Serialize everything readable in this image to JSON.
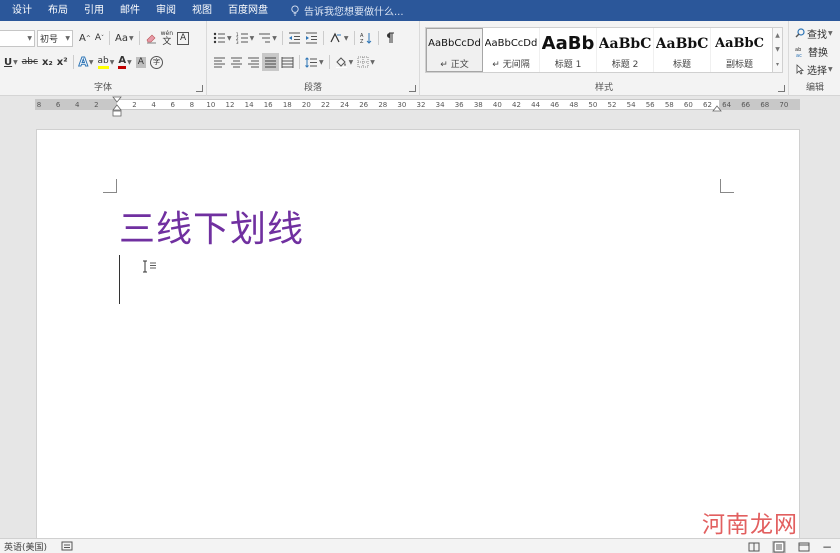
{
  "tabs": [
    "设计",
    "布局",
    "引用",
    "邮件",
    "审阅",
    "视图",
    "百度网盘"
  ],
  "tell_me": "告诉我您想要做什么...",
  "font": {
    "size": "初号",
    "grow_label": "A",
    "shrink_label": "A",
    "case_label": "Aa",
    "phonetic_label": "wén",
    "phonetic_char": "文",
    "border_char": "A",
    "underline_label": "U",
    "strike_label": "abc",
    "sub_label": "x₂",
    "sup_label": "x²",
    "effects_label": "A",
    "highlight_label": "ab",
    "color_label": "A",
    "shade_label": "A",
    "enclose_label": "字",
    "group_label": "字体"
  },
  "paragraph": {
    "group_label": "段落"
  },
  "styles": {
    "group_label": "样式",
    "items": [
      {
        "sample": "AaBbCcDd",
        "name": "↵ 正文"
      },
      {
        "sample": "AaBbCcDd",
        "name": "↵ 无间隔"
      },
      {
        "sample": "AaBb",
        "name": "标题 1"
      },
      {
        "sample": "AaBbC",
        "name": "标题 2"
      },
      {
        "sample": "AaBbC",
        "name": "标题"
      },
      {
        "sample": "AaBbC",
        "name": "副标题"
      }
    ]
  },
  "editing": {
    "find": "查找",
    "replace": "替换",
    "select": "选择",
    "group_label": "编辑"
  },
  "ruler": {
    "numbers": [
      "8",
      "6",
      "4",
      "2",
      "",
      "2",
      "4",
      "6",
      "8",
      "10",
      "12",
      "14",
      "16",
      "18",
      "20",
      "22",
      "24",
      "26",
      "28",
      "30",
      "32",
      "34",
      "36",
      "38",
      "40",
      "42",
      "44",
      "46",
      "48",
      "50",
      "52",
      "54",
      "56",
      "58",
      "60",
      "62",
      "64",
      "66",
      "68",
      "70"
    ]
  },
  "document": {
    "title": "三线下划线",
    "title_color": "#7030a0"
  },
  "statusbar": {
    "language": "英语(美国)"
  },
  "watermark": "河南龙网",
  "colors": {
    "tabbar": "#2b579a",
    "accent_red": "#c00000",
    "highlight_yellow": "#ffff00"
  }
}
